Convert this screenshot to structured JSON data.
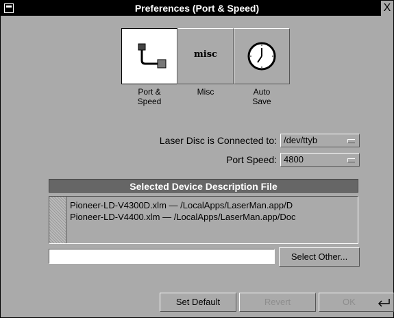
{
  "window": {
    "title": "Preferences (Port & Speed)",
    "close_glyph": "X"
  },
  "tabs": [
    {
      "label_line1": "Port &",
      "label_line2": "Speed",
      "icon": "cable-port-icon",
      "selected": true
    },
    {
      "label_line1": "Misc",
      "label_line2": "",
      "icon": "misc-icon",
      "icon_text": "misc",
      "selected": false
    },
    {
      "label_line1": "Auto",
      "label_line2": "Save",
      "icon": "clock-icon",
      "selected": false
    }
  ],
  "connection": {
    "port_label": "Laser Disc is Connected to:",
    "port_value": "/dev/ttyb",
    "speed_label": "Port Speed:",
    "speed_value": "4800"
  },
  "device_section": {
    "header": "Selected Device Description File",
    "files": [
      "Pioneer-LD-V4300D.xlm — /LocalApps/LaserMan.app/D",
      "Pioneer-LD-V4400.xlm — /LocalApps/LaserMan.app/Doc"
    ],
    "path_value": "",
    "select_other_label": "Select Other..."
  },
  "footer": {
    "set_default_label": "Set Default",
    "revert_label": "Revert",
    "ok_label": "OK"
  },
  "colors": {
    "background": "#aaaaaa",
    "titlebar": "#000000",
    "header": "#666666"
  }
}
